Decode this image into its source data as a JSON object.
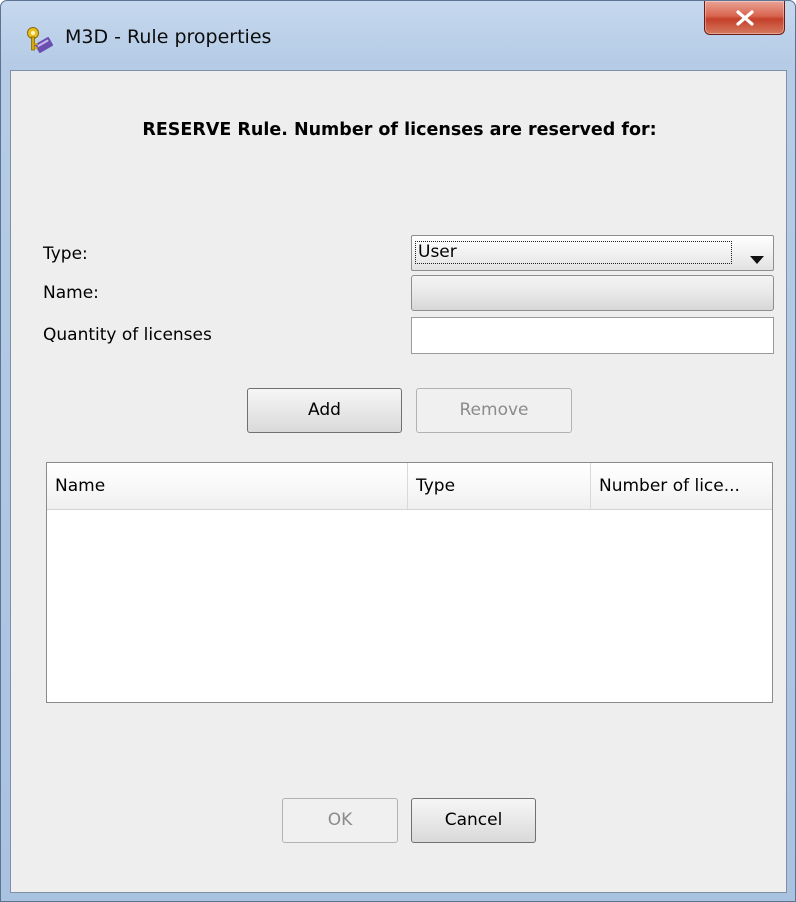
{
  "window": {
    "title": "M3D - Rule properties",
    "icon": "key-ruler-app-icon",
    "close_icon": "close-icon"
  },
  "dialog": {
    "heading": "RESERVE Rule. Number of licenses are reserved for:",
    "form": {
      "type_label": "Type:",
      "type_value": "User",
      "name_label": "Name:",
      "name_value": "",
      "quantity_label": "Quantity of licenses",
      "quantity_value": ""
    },
    "buttons": {
      "add": "Add",
      "remove": "Remove",
      "ok": "OK",
      "cancel": "Cancel"
    },
    "table": {
      "columns": [
        "Name",
        "Type",
        "Number of lice..."
      ],
      "rows": []
    }
  },
  "colors": {
    "client_bg": "#eeeeee",
    "disabled_text": "#8b8b8b",
    "close_button": "#c5402a"
  }
}
